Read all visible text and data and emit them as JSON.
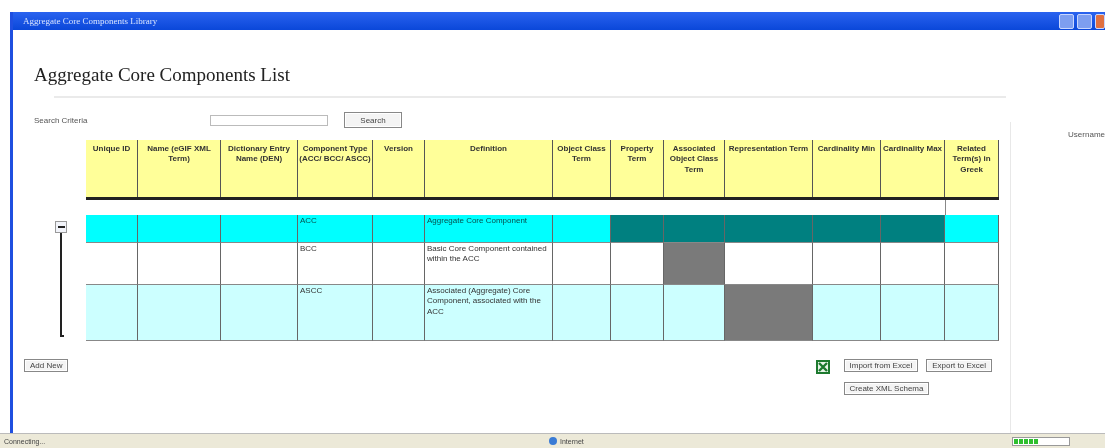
{
  "window": {
    "title": "Aggregate Core Components Library"
  },
  "page_title": "Aggregate Core Components List",
  "search": {
    "label": "Search Criteria",
    "button": "Search"
  },
  "user": {
    "label": "Username"
  },
  "table": {
    "columns": [
      "Unique ID",
      "Name (eGIF XML Term)",
      "Dictionary Entry Name (DEN)",
      "Component Type (ACC/ BCC/ ASCC)",
      "Version",
      "Definition",
      "Object Class Term",
      "Property Term",
      "Associated Object Class Term",
      "Representation Term",
      "Cardinality Min",
      "Cardinality Max",
      "Related Term(s) in Greek"
    ],
    "group": {
      "expanded": true
    },
    "rows": [
      {
        "kind": "aggregate",
        "cells": [
          {
            "blocked": false
          },
          {
            "blocked": false
          },
          {
            "blocked": false
          },
          {
            "text": "ACC",
            "blocked": false
          },
          {
            "blocked": false
          },
          {
            "text": "Aggregate Core Component",
            "blocked": false
          },
          {
            "blocked": false
          },
          {
            "blocked": true
          },
          {
            "blocked": true
          },
          {
            "blocked": true
          },
          {
            "blocked": true
          },
          {
            "blocked": true
          },
          {
            "blocked": false
          }
        ]
      },
      {
        "kind": "basic",
        "cells": [
          {
            "blocked": false
          },
          {
            "blocked": false
          },
          {
            "blocked": false
          },
          {
            "text": "BCC",
            "blocked": false
          },
          {
            "blocked": false
          },
          {
            "text": "Basic Core Component contained within the ACC",
            "blocked": false
          },
          {
            "blocked": false
          },
          {
            "blocked": false
          },
          {
            "blocked": true
          },
          {
            "blocked": false
          },
          {
            "blocked": false
          },
          {
            "blocked": false
          },
          {
            "blocked": false
          }
        ]
      },
      {
        "kind": "association",
        "cells": [
          {
            "blocked": false
          },
          {
            "blocked": false
          },
          {
            "blocked": false
          },
          {
            "text": "ASCC",
            "blocked": false
          },
          {
            "blocked": false
          },
          {
            "text": "Associated (Aggregate) Core Component, associated with the ACC",
            "blocked": false
          },
          {
            "blocked": false
          },
          {
            "blocked": false
          },
          {
            "blocked": false
          },
          {
            "blocked": true
          },
          {
            "blocked": false
          },
          {
            "blocked": false
          },
          {
            "blocked": false
          }
        ]
      }
    ]
  },
  "actions": {
    "add": "Add New",
    "import": "Import from Excel",
    "export": "Export to Excel",
    "schema": "Create XML Schema"
  },
  "status_bar": {
    "left": "Connecting...",
    "zone": "Internet",
    "progress": {
      "level": 0.45
    }
  }
}
